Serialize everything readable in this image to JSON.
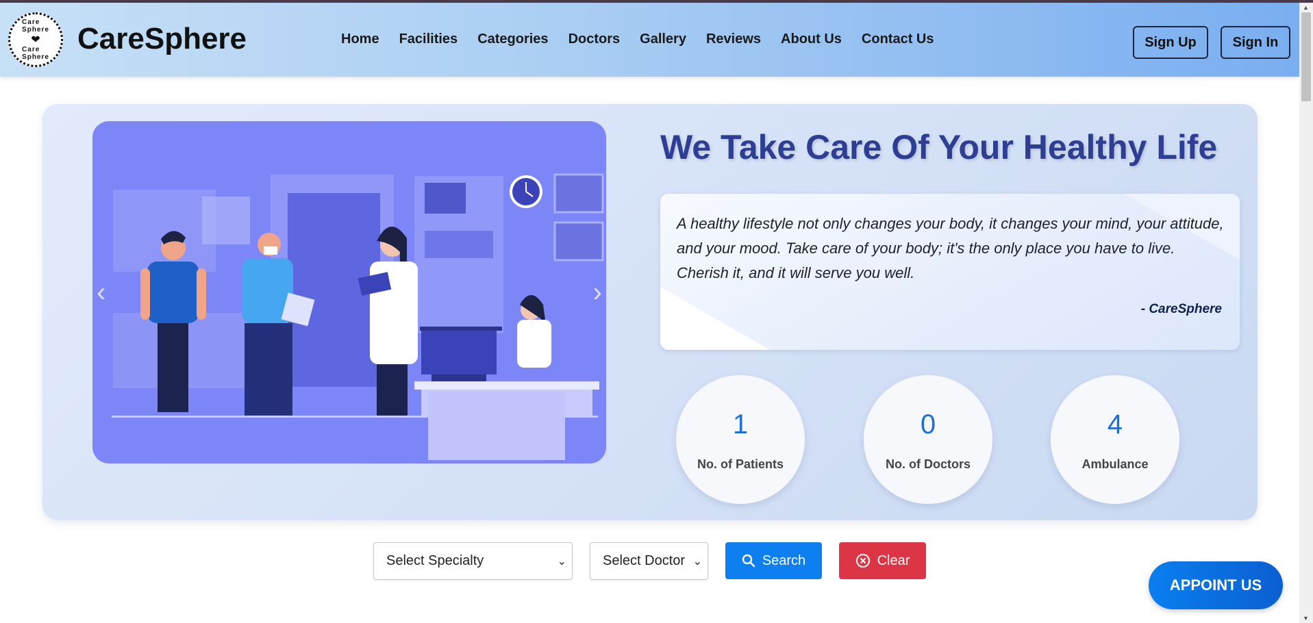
{
  "brand": {
    "name": "CareSphere",
    "logo_text": "Care Sphere"
  },
  "nav": {
    "items": [
      "Home",
      "Facilities",
      "Categories",
      "Doctors",
      "Gallery",
      "Reviews",
      "About Us",
      "Contact Us"
    ]
  },
  "auth": {
    "signup": "Sign Up",
    "signin": "Sign In"
  },
  "hero": {
    "title": "We Take Care Of Your Healthy Life",
    "quote": "A healthy lifestyle not only changes your body, it changes your mind, your attitude, and your mood. Take care of your body; it's the only place you have to live. Cherish it, and it will serve you well.",
    "quote_author": "- CareSphere",
    "carousel": {
      "prev_icon": "chevron-left-icon",
      "next_icon": "chevron-right-icon"
    }
  },
  "stats": [
    {
      "value": "1",
      "label": "No. of Patients"
    },
    {
      "value": "0",
      "label": "No. of Doctors"
    },
    {
      "value": "4",
      "label": "Ambulance"
    }
  ],
  "search": {
    "specialty_selected": "Select Specialty",
    "doctor_selected": "Select Doctor",
    "search_label": "Search",
    "clear_label": "Clear"
  },
  "appoint": {
    "label": "APPOINT US"
  },
  "colors": {
    "accent": "#0d7ff0",
    "danger": "#dc3545",
    "title": "#2e3e93",
    "carousel_bg": "#7d86f7"
  }
}
